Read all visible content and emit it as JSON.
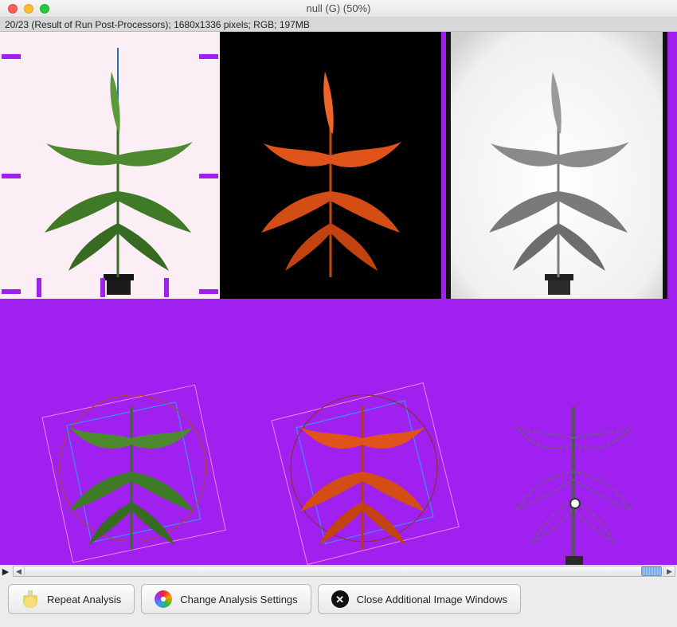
{
  "window": {
    "title": "null (G) (50%)",
    "info": "20/23 (Result of Run Post-Processors); 1680x1336 pixels; RGB; 197MB"
  },
  "buttons": {
    "repeat": "Repeat Analysis",
    "change": "Change Analysis Settings",
    "close": "Close Additional Image Windows"
  },
  "scroll": {
    "play_glyph": "▶"
  }
}
